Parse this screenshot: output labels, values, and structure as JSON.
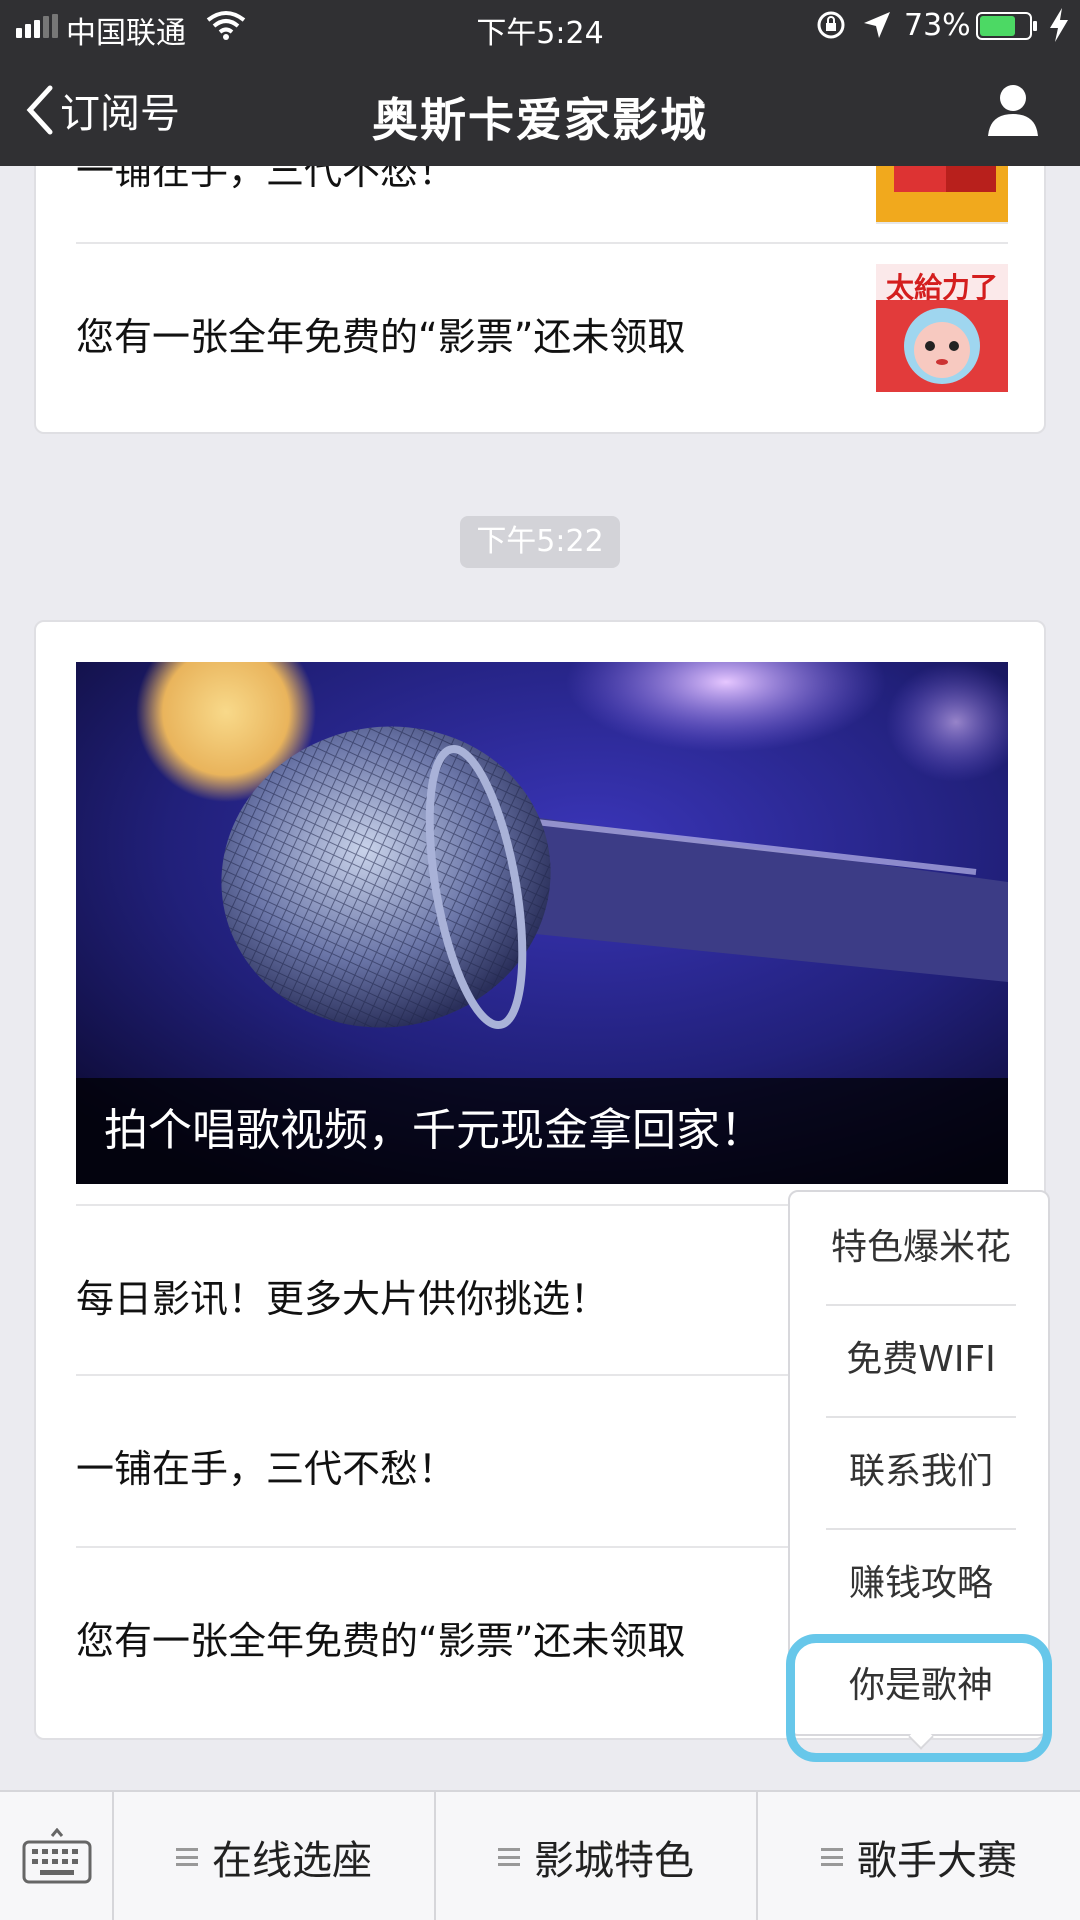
{
  "status_bar": {
    "carrier": "中国联通",
    "time": "下午5:24",
    "battery_percent": "73%",
    "battery_level": 0.73,
    "battery_color": "#4cd964"
  },
  "nav": {
    "back_label": "订阅号",
    "title": "奥斯卡爱家影城"
  },
  "top_card": {
    "cut_row_text": "一铺在手，三代不愁！",
    "row_text": "您有一张全年免费的“影票”还未领取",
    "thumb_text": "太給力了"
  },
  "timestamp": "下午5:22",
  "article_card": {
    "cover_caption": "拍个唱歌视频，千元现金拿回家！",
    "rows": [
      "每日影讯！更多大片供你挑选！",
      "一铺在手，三代不愁！",
      "您有一张全年免费的“影票”还未领取"
    ]
  },
  "popup_menu": {
    "items": [
      "特色爆米花",
      "免费WIFI",
      "联系我们",
      "赚钱攻略",
      "你是歌神"
    ],
    "highlight_color": "#67c7ea"
  },
  "bottom_bar": {
    "tabs": [
      "在线选座",
      "影城特色",
      "歌手大赛"
    ]
  }
}
